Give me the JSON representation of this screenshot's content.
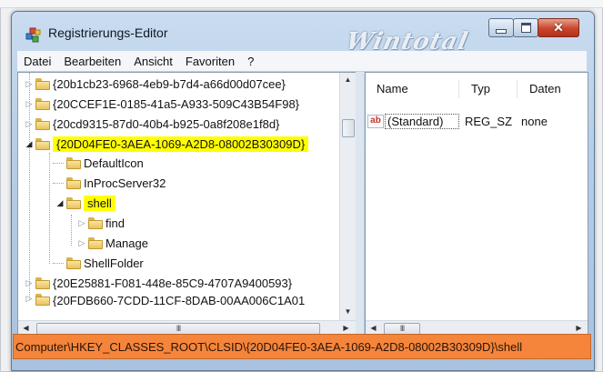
{
  "window": {
    "title": "Registrierungs-Editor",
    "watermark": "Wintotal"
  },
  "menu": [
    "Datei",
    "Bearbeiten",
    "Ansicht",
    "Favoriten",
    "?"
  ],
  "tree": {
    "rows": [
      {
        "label": "{20b1cb23-6968-4eb9-b7d4-a66d00d07cee}",
        "expander": "▷"
      },
      {
        "label": "{20CCEF1E-0185-41a5-A933-509C43B54F98}",
        "expander": "▷"
      },
      {
        "label": "{20cd9315-87d0-40b4-b925-0a8f208e1f8d}",
        "expander": "▷"
      },
      {
        "label": "{20D04FE0-3AEA-1069-A2D8-08002B30309D}",
        "expander": "◢"
      },
      {
        "label": "DefaultIcon",
        "expander": ""
      },
      {
        "label": "InProcServer32",
        "expander": ""
      },
      {
        "label": "shell",
        "expander": "◢"
      },
      {
        "label": "find",
        "expander": "▷"
      },
      {
        "label": "Manage",
        "expander": "▷"
      },
      {
        "label": "ShellFolder",
        "expander": ""
      },
      {
        "label": "{20E25881-F081-448e-85C9-4707A9400593}",
        "expander": "▷"
      },
      {
        "label": "{20FDB660-7CDD-11CF-8DAB-00AA006C1A01",
        "expander": "▷"
      }
    ],
    "hscroll_grip": "III"
  },
  "values": {
    "columns": [
      "Name",
      "Typ",
      "Daten"
    ],
    "rows": [
      {
        "icon": "ab",
        "name": "(Standard)",
        "type": "REG_SZ",
        "data": "none"
      }
    ],
    "hscroll_grip": "III"
  },
  "status_path": "Computer\\HKEY_CLASSES_ROOT\\CLSID\\{20D04FE0-3AEA-1069-A2D8-08002B30309D}\\shell",
  "colors": {
    "highlight": "#ffff00",
    "statusbar": "#f4853a",
    "window_frame": "#b7cde6"
  }
}
